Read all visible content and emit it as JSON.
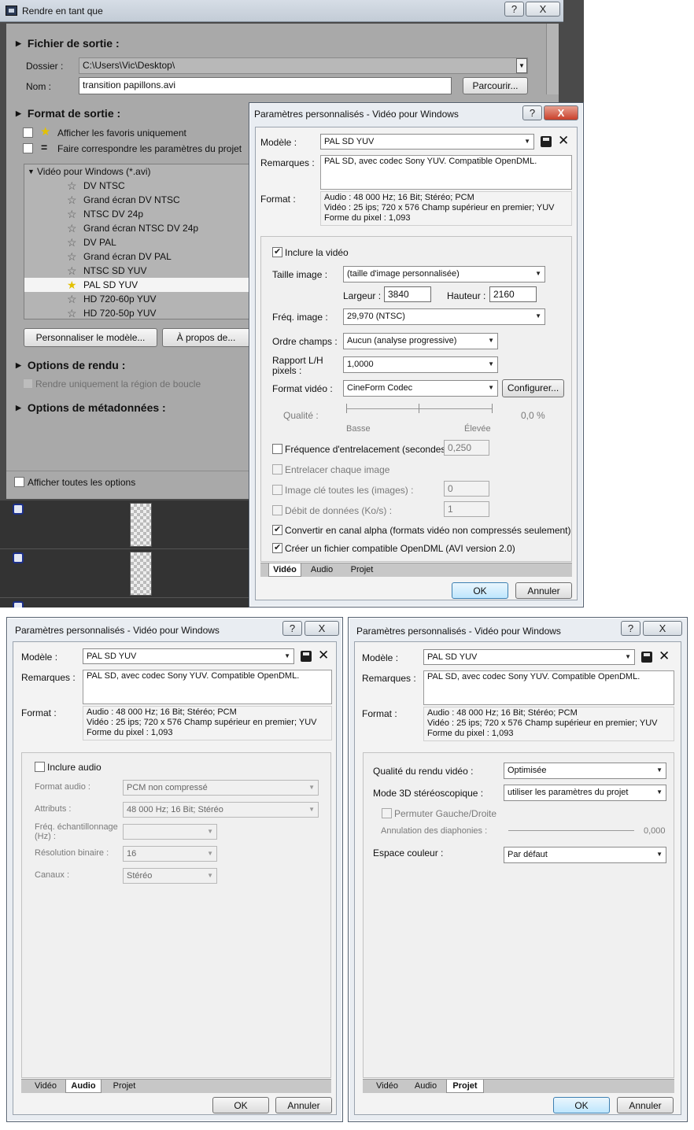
{
  "main": {
    "title": "Rendre en tant que",
    "sections": {
      "output_file": "Fichier de sortie :",
      "output_format": "Format de sortie :",
      "render_options": "Options de rendu :",
      "metadata_options": "Options de métadonnées :"
    },
    "folder_label": "Dossier :",
    "folder_value": "C:\\Users\\Vic\\Desktop\\",
    "name_label": "Nom :",
    "name_value": "transition papillons.avi",
    "browse_button": "Parcourir...",
    "show_favorites": "Afficher les favoris uniquement",
    "match_project": "Faire correspondre les paramètres du projet",
    "tree_root": "Vidéo pour Windows (*.avi)",
    "tree_items": [
      "DV NTSC",
      "Grand écran DV NTSC",
      "NTSC DV 24p",
      "Grand écran NTSC DV 24p",
      "DV PAL",
      "Grand écran DV PAL",
      "NTSC SD YUV",
      "PAL SD YUV",
      "HD 720-60p YUV",
      "HD 720-50p YUV"
    ],
    "customize_button": "Personnaliser le modèle...",
    "about_button": "À propos de...",
    "loop_region": "Rendre uniquement la région de boucle",
    "show_all_options": "Afficher toutes les options"
  },
  "dialog_common": {
    "title": "Paramètres personnalisés - Vidéo pour Windows",
    "help_button": "?",
    "close_button": "X",
    "model_label": "Modèle :",
    "model_value": "PAL SD YUV",
    "remarks_label": "Remarques :",
    "remarks_value": "PAL SD, avec codec Sony YUV. Compatible OpenDML.",
    "format_label": "Format :",
    "format_lines": [
      "Audio : 48 000 Hz; 16 Bit; Stéréo; PCM",
      "Vidéo : 25 ips; 720 x 576 Champ supérieur en premier; YUV",
      "Forme du pixel : 1,093"
    ],
    "tabs": [
      "Vidéo",
      "Audio",
      "Projet"
    ],
    "ok_button": "OK",
    "cancel_button": "Annuler"
  },
  "video_tab": {
    "include_video": "Inclure la vidéo",
    "frame_size_label": "Taille image :",
    "frame_size_value": "(taille d'image personnalisée)",
    "width_label": "Largeur :",
    "width_value": "3840",
    "height_label": "Hauteur :",
    "height_value": "2160",
    "frame_rate_label": "Fréq. image :",
    "frame_rate_value": "29,970 (NTSC)",
    "field_order_label": "Ordre champs :",
    "field_order_value": "Aucun (analyse progressive)",
    "pixel_aspect_label_1": "Rapport L/H",
    "pixel_aspect_label_2": "pixels :",
    "pixel_aspect_value": "1,0000",
    "video_format_label": "Format vidéo :",
    "video_format_value": "CineForm Codec",
    "configure_button": "Configurer...",
    "quality_label": "Qualité :",
    "quality_value": "0,0 %",
    "quality_low": "Basse",
    "quality_high": "Élevée",
    "interleave_label": "Fréquence d'entrelacement (secondes) :",
    "interleave_value": "0,250",
    "interleave_each_frame": "Entrelacer chaque image",
    "keyframe_label": "Image clé toutes les (images) :",
    "keyframe_value": "0",
    "data_rate_label": "Débit de données (Ko/s) :",
    "data_rate_value": "1",
    "alpha_channel": "Convertir en canal alpha (formats vidéo non compressés seulement)",
    "opendml": "Créer un fichier compatible OpenDML (AVI version 2.0)"
  },
  "audio_tab": {
    "include_audio": "Inclure audio",
    "audio_format_label": "Format audio :",
    "audio_format_value": "PCM non compressé",
    "attributes_label": "Attributs :",
    "attributes_value": "48 000 Hz; 16 Bit; Stéréo",
    "sample_rate_label_1": "Fréq. échantillonnage",
    "sample_rate_label_2": "(Hz) :",
    "sample_rate_value": "",
    "bit_depth_label": "Résolution binaire :",
    "bit_depth_value": "16",
    "channels_label": "Canaux :",
    "channels_value": "Stéréo"
  },
  "project_tab": {
    "render_quality_label": "Qualité du rendu vidéo :",
    "render_quality_value": "Optimisée",
    "stereo3d_label": "Mode 3D stéréoscopique :",
    "stereo3d_value": "utiliser les paramètres du projet",
    "swap_lr": "Permuter Gauche/Droite",
    "crosstalk_label": "Annulation des diaphonies :",
    "crosstalk_value": "0,000",
    "color_space_label": "Espace couleur :",
    "color_space_value": "Par défaut"
  }
}
